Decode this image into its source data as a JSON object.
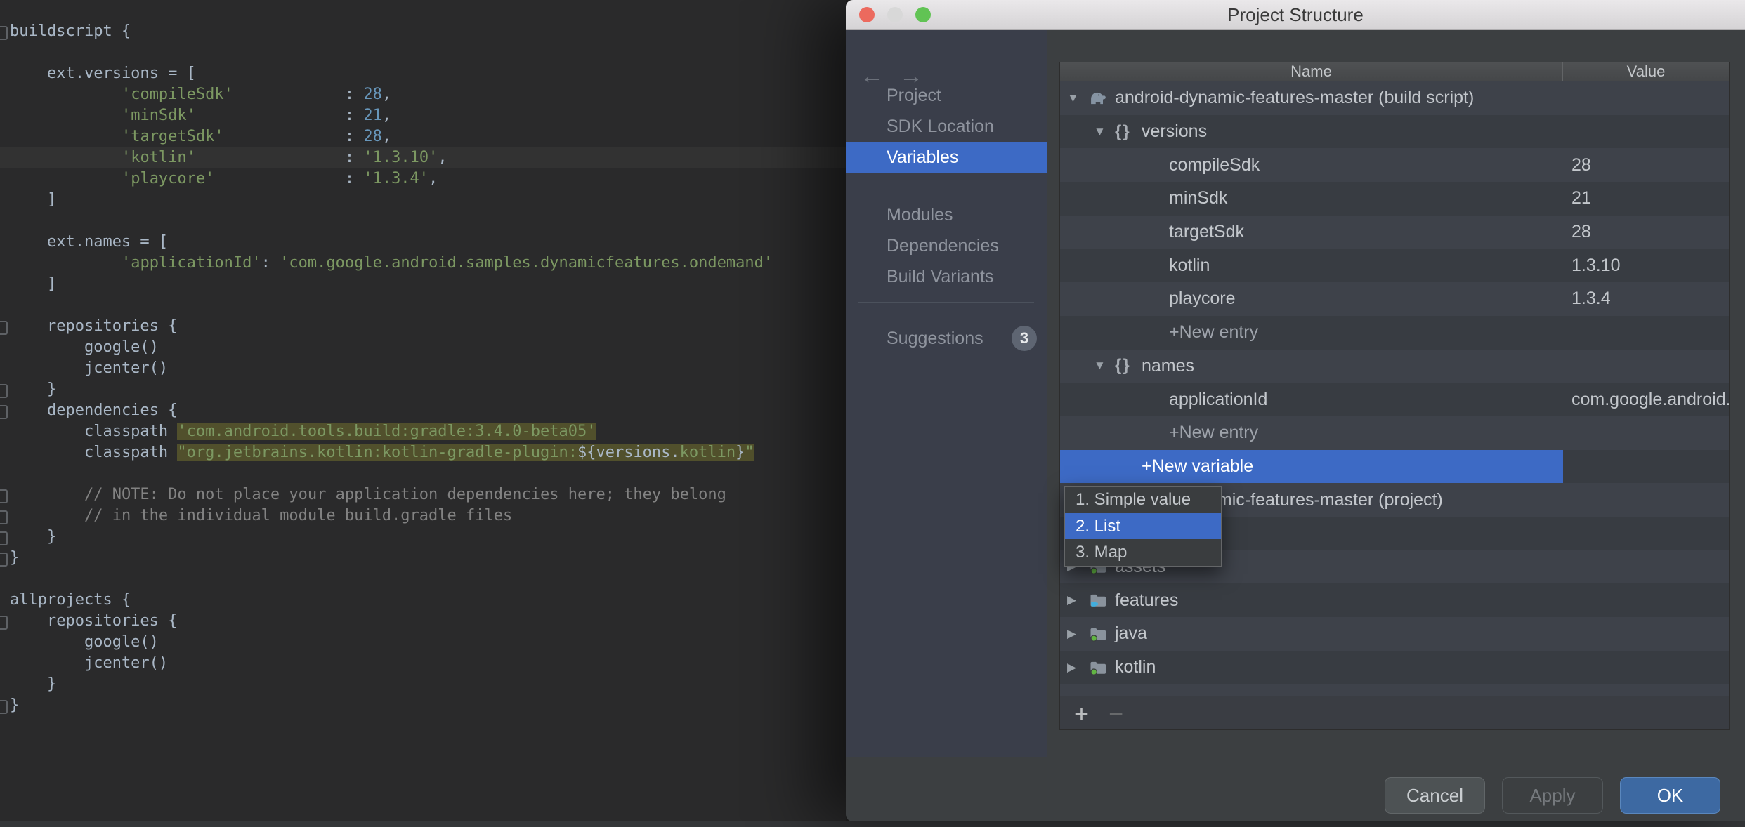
{
  "window": {
    "title": "Project Structure"
  },
  "nav": {
    "back": "←",
    "forward": "→"
  },
  "colors": {
    "accent_selection": "#3D6AC5",
    "ok_button": "#3D69A2",
    "traffic_close": "#EC6A5E",
    "traffic_minimize": "#D8D8D8",
    "traffic_zoom": "#61C354",
    "string_green": "#7C9862",
    "number_blue": "#6897BB",
    "comment_gray": "#828282",
    "match_highlight": "#51502C",
    "suggestion_badge": "#5E6572"
  },
  "sidebar": {
    "groups": [
      {
        "items": [
          {
            "label": "Project",
            "selected": false
          },
          {
            "label": "SDK Location",
            "selected": false
          },
          {
            "label": "Variables",
            "selected": true
          }
        ]
      },
      {
        "items": [
          {
            "label": "Modules",
            "selected": false
          },
          {
            "label": "Dependencies",
            "selected": false
          },
          {
            "label": "Build Variants",
            "selected": false
          }
        ]
      },
      {
        "items": [
          {
            "label": "Suggestions",
            "selected": false,
            "badge": "3"
          }
        ]
      }
    ]
  },
  "table": {
    "columns": [
      "Name",
      "Value"
    ],
    "rows": [
      {
        "indent": 0,
        "arrow": "down",
        "icon": "gradle",
        "name": "android-dynamic-features-master (build script)",
        "value": ""
      },
      {
        "indent": 1,
        "arrow": "down",
        "icon": "braces",
        "name": "versions",
        "value": ""
      },
      {
        "indent": 2,
        "name": "compileSdk",
        "value": "28"
      },
      {
        "indent": 2,
        "name": "minSdk",
        "value": "21"
      },
      {
        "indent": 2,
        "name": "targetSdk",
        "value": "28"
      },
      {
        "indent": 2,
        "name": "kotlin",
        "value": "1.3.10"
      },
      {
        "indent": 2,
        "name": "playcore",
        "value": "1.3.4"
      },
      {
        "indent": 2,
        "name": "+New entry",
        "value": "",
        "muted": true
      },
      {
        "indent": 1,
        "arrow": "down",
        "icon": "braces",
        "name": "names",
        "value": ""
      },
      {
        "indent": 2,
        "name": "applicationId",
        "value": "com.google.android.samples.dynamicfeatures.ondemand"
      },
      {
        "indent": 2,
        "name": "+New entry",
        "value": "",
        "muted": true
      },
      {
        "indent": 1,
        "arrow": null,
        "icon": null,
        "name": "+New variable",
        "value": "",
        "selected": true
      },
      {
        "indent": 0,
        "arrow": "right",
        "icon": "gradle",
        "name": "android-dynamic-features-master (project)",
        "value": ""
      },
      {
        "empty": true
      },
      {
        "indent": 0,
        "arrow": "right",
        "icon": "folder",
        "name": "assets",
        "value": ""
      },
      {
        "indent": 0,
        "arrow": "right",
        "icon": "folder-feature",
        "name": "features",
        "value": ""
      },
      {
        "indent": 0,
        "arrow": "right",
        "icon": "folder",
        "name": "java",
        "value": ""
      },
      {
        "indent": 0,
        "arrow": "right",
        "icon": "folder",
        "name": "kotlin",
        "value": ""
      }
    ]
  },
  "dropdown": {
    "items": [
      {
        "label": "1. Simple value",
        "selected": false
      },
      {
        "label": "2. List",
        "selected": true
      },
      {
        "label": "3. Map",
        "selected": false
      }
    ]
  },
  "toolbar": {
    "add": "+",
    "remove": "−"
  },
  "footer": {
    "buttons": [
      {
        "label": "Cancel",
        "style": "normal"
      },
      {
        "label": "Apply",
        "style": "disabled"
      },
      {
        "label": "OK",
        "style": "primary"
      }
    ]
  },
  "editor": {
    "caret_line": 7,
    "marker_lines": [
      1,
      15,
      18,
      19,
      23,
      24,
      25,
      26,
      29,
      33
    ],
    "lines": [
      [
        [
          "buildscript {",
          "p"
        ]
      ],
      [],
      [
        [
          "    ext.versions = [",
          "p"
        ]
      ],
      [
        [
          "            ",
          "p"
        ],
        [
          "'compileSdk'",
          "s"
        ],
        [
          "            : ",
          "p"
        ],
        [
          "28",
          "n"
        ],
        [
          ",",
          "p"
        ]
      ],
      [
        [
          "            ",
          "p"
        ],
        [
          "'minSdk'",
          "s"
        ],
        [
          "                : ",
          "p"
        ],
        [
          "21",
          "n"
        ],
        [
          ",",
          "p"
        ]
      ],
      [
        [
          "            ",
          "p"
        ],
        [
          "'targetSdk'",
          "s"
        ],
        [
          "             : ",
          "p"
        ],
        [
          "28",
          "n"
        ],
        [
          ",",
          "p"
        ]
      ],
      [
        [
          "            ",
          "p"
        ],
        [
          "'kotlin'",
          "s"
        ],
        [
          "                : ",
          "p"
        ],
        [
          "'1.3.10'",
          "s"
        ],
        [
          ",",
          "p"
        ]
      ],
      [
        [
          "            ",
          "p"
        ],
        [
          "'playcore'",
          "s"
        ],
        [
          "              : ",
          "p"
        ],
        [
          "'1.3.4'",
          "s"
        ],
        [
          ",",
          "p"
        ]
      ],
      [
        [
          "    ]",
          "p"
        ]
      ],
      [],
      [
        [
          "    ext.names = [",
          "p"
        ]
      ],
      [
        [
          "            ",
          "p"
        ],
        [
          "'applicationId'",
          "s"
        ],
        [
          ": ",
          "p"
        ],
        [
          "'com.google.android.samples.dynamicfeatures.ondemand'",
          "s"
        ]
      ],
      [
        [
          "    ]",
          "p"
        ]
      ],
      [],
      [
        [
          "    repositories {",
          "p"
        ]
      ],
      [
        [
          "        google()",
          "p"
        ]
      ],
      [
        [
          "        jcenter()",
          "p"
        ]
      ],
      [
        [
          "    }",
          "p"
        ]
      ],
      [
        [
          "    dependencies {",
          "p"
        ]
      ],
      [
        [
          "        classpath ",
          "p"
        ],
        [
          "'com.android.tools.build:gradle:3.4.0-beta05'",
          "s",
          1
        ]
      ],
      [
        [
          "        classpath ",
          "p"
        ],
        [
          "\"org.jetbrains.kotlin:kotlin-gradle-plugin:",
          "s",
          1
        ],
        [
          "${versions.",
          "p",
          1
        ],
        [
          "kotlin",
          "s",
          1
        ],
        [
          "}",
          "p",
          1
        ],
        [
          "\"",
          "s",
          1
        ]
      ],
      [],
      [
        [
          "        // NOTE: Do not place your application dependencies here; they belong",
          "c"
        ]
      ],
      [
        [
          "        // in the individual module build.gradle files",
          "c"
        ]
      ],
      [
        [
          "    }",
          "p"
        ]
      ],
      [
        [
          "}",
          "p"
        ]
      ],
      [],
      [
        [
          "allprojects {",
          "p"
        ]
      ],
      [
        [
          "    repositories {",
          "p"
        ]
      ],
      [
        [
          "        google()",
          "p"
        ]
      ],
      [
        [
          "        jcenter()",
          "p"
        ]
      ],
      [
        [
          "    }",
          "p"
        ]
      ],
      [
        [
          "}",
          "p"
        ]
      ]
    ]
  }
}
